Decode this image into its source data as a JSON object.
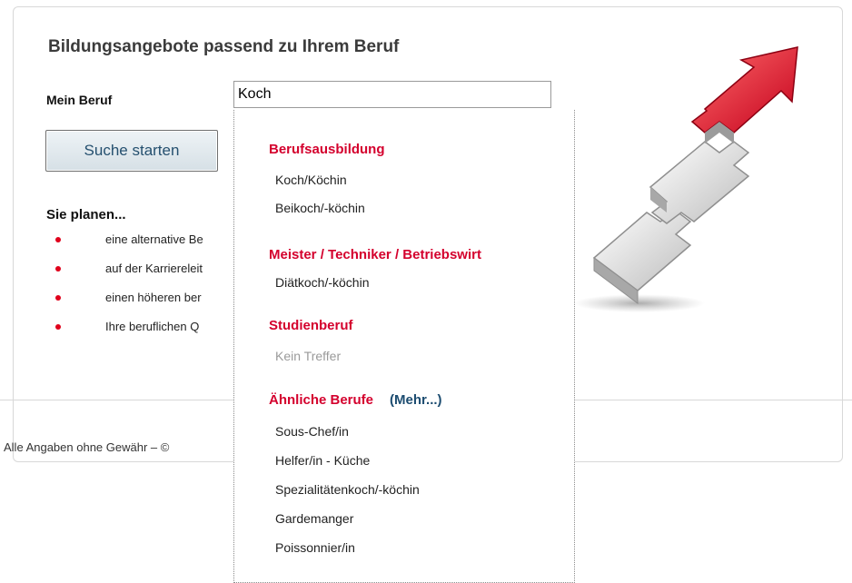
{
  "page": {
    "title": "Bildungsangebote passend zu Ihrem Beruf",
    "beruf_label": "Mein Beruf",
    "beruf_value": "Koch",
    "search_button": "Suche starten",
    "plan_heading": "Sie planen...",
    "bullets": [
      "eine alternative Be",
      "auf der Karriereleit",
      "einen höheren ber",
      "Ihre beruflichen Q"
    ],
    "footer": "Alle Angaben ohne Gewähr – ©"
  },
  "dropdown": {
    "sections": [
      {
        "title": "Berufsausbildung",
        "items": [
          "Koch/Köchin",
          "Beikoch/-köchin"
        ]
      },
      {
        "title": "Meister / Techniker / Betriebswirt",
        "items": [
          "Diätkoch/-köchin"
        ]
      },
      {
        "title": "Studienberuf",
        "items": [
          "Kein Treffer"
        ]
      },
      {
        "title": "Ähnliche Berufe",
        "more": "(Mehr...)",
        "items": [
          "Sous-Chef/in",
          "Helfer/in - Küche",
          "Spezialitätenkoch/-köchin",
          "Gardemanger",
          "Poissonnier/in"
        ]
      }
    ]
  },
  "colors": {
    "accent_red": "#d4002d",
    "link_blue": "#1c4c70",
    "button_text": "#25506f"
  }
}
